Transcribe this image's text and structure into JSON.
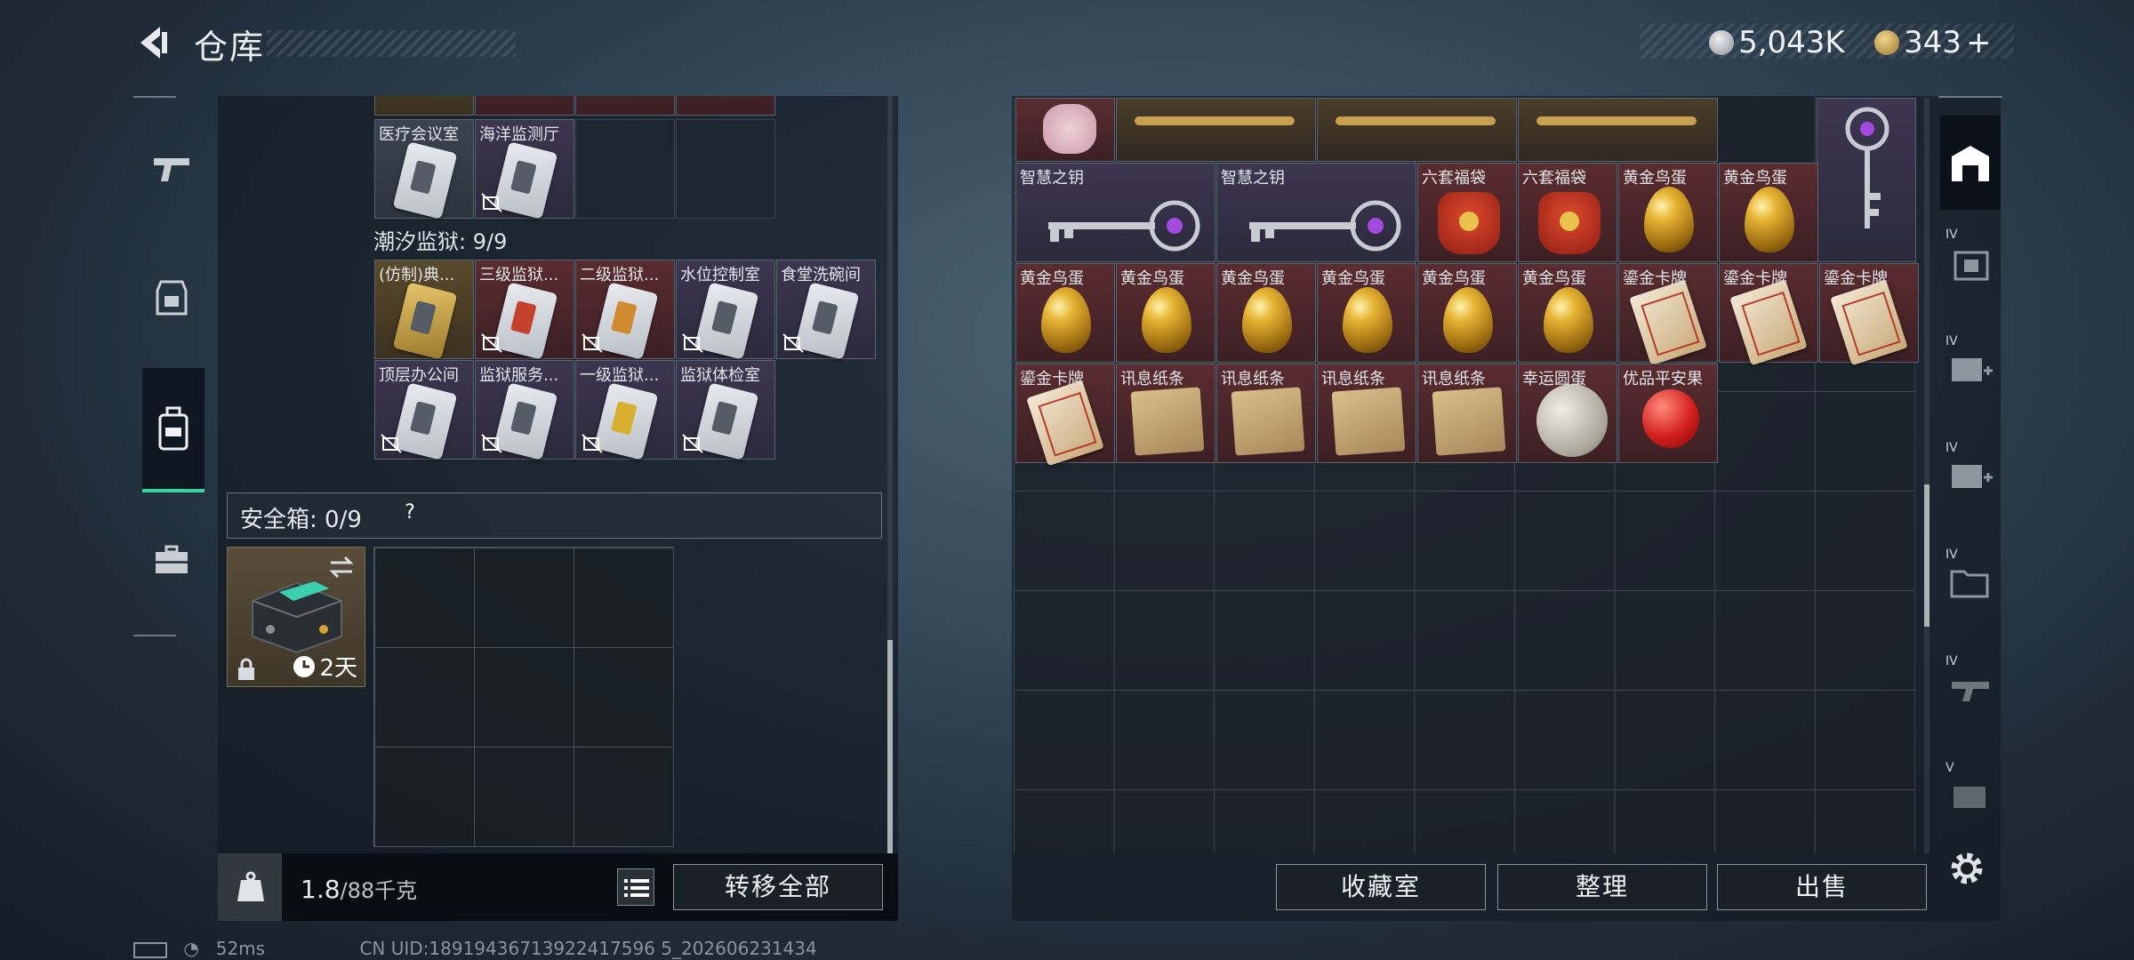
{
  "header": {
    "title": "仓库"
  },
  "currency": {
    "coins": "5,043K",
    "tickets": "343",
    "plus": "+"
  },
  "left": {
    "top_row": [
      {
        "label": "医疗会议室"
      },
      {
        "label": "海洋监测厅"
      }
    ],
    "section_title": "潮汐监狱: 9/9",
    "prison_row1": [
      {
        "label": "(仿制)典..."
      },
      {
        "label": "三级监狱..."
      },
      {
        "label": "二级监狱..."
      },
      {
        "label": "水位控制室"
      },
      {
        "label": "食堂洗碗间"
      }
    ],
    "prison_row2": [
      {
        "label": "顶层办公间"
      },
      {
        "label": "监狱服务..."
      },
      {
        "label": "一级监狱..."
      },
      {
        "label": "监狱体检室"
      }
    ],
    "safe": {
      "label": "安全箱: 0/9",
      "help": "?",
      "timer": "2天"
    },
    "weight": {
      "value": "1.8",
      "unit": "/88千克"
    },
    "transfer_all": "转移全部"
  },
  "right": {
    "row1": [
      {
        "label": "智慧之钥"
      },
      {
        "label": "智慧之钥"
      },
      {
        "label": "六套福袋"
      },
      {
        "label": "六套福袋"
      },
      {
        "label": "黄金鸟蛋"
      },
      {
        "label": "黄金鸟蛋"
      }
    ],
    "row2": [
      {
        "label": "黄金鸟蛋"
      },
      {
        "label": "黄金鸟蛋"
      },
      {
        "label": "黄金鸟蛋"
      },
      {
        "label": "黄金鸟蛋"
      },
      {
        "label": "黄金鸟蛋"
      },
      {
        "label": "黄金鸟蛋"
      },
      {
        "label": "鎏金卡牌"
      },
      {
        "label": "鎏金卡牌"
      },
      {
        "label": "鎏金卡牌"
      }
    ],
    "row3": [
      {
        "label": "鎏金卡牌"
      },
      {
        "label": "讯息纸条"
      },
      {
        "label": "讯息纸条"
      },
      {
        "label": "讯息纸条"
      },
      {
        "label": "讯息纸条"
      },
      {
        "label": "幸运圆蛋"
      },
      {
        "label": "优品平安果"
      }
    ],
    "buttons": {
      "collection": "收藏室",
      "sort": "整理",
      "sell": "出售"
    }
  },
  "right_rail": {
    "tiers": [
      "IV",
      "IV",
      "IV",
      "IV",
      "IV",
      "V"
    ]
  },
  "status": {
    "ping": "52ms",
    "uid": "CN UID:18919436713922417596 5_202606231434"
  }
}
